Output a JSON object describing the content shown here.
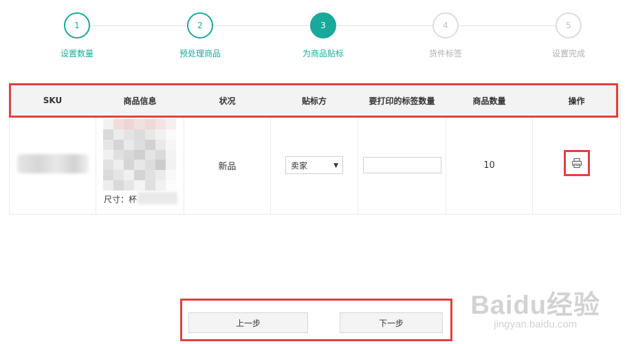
{
  "stepper": {
    "steps": [
      {
        "number": "1",
        "label": "设置数量",
        "state": "done"
      },
      {
        "number": "2",
        "label": "预处理商品",
        "state": "done"
      },
      {
        "number": "3",
        "label": "为商品贴标",
        "state": "active"
      },
      {
        "number": "4",
        "label": "货件标签",
        "state": "pending"
      },
      {
        "number": "5",
        "label": "设置完成",
        "state": "pending"
      }
    ]
  },
  "table": {
    "headers": [
      "SKU",
      "商品信息",
      "状况",
      "贴标方",
      "要打印的标签数量",
      "商品数量",
      "操作"
    ],
    "row": {
      "product_size_label": "尺寸：杯",
      "condition": "新品",
      "labeler_selected": "卖家",
      "print_quantity_value": "",
      "quantity": "10"
    }
  },
  "footer": {
    "prev_label": "上一步",
    "next_label": "下一步"
  },
  "watermark": {
    "logo": "Baidu经验",
    "url": "jingyan.baidu.com"
  },
  "colors": {
    "accent": "#19a99a",
    "highlight": "#e04040"
  }
}
